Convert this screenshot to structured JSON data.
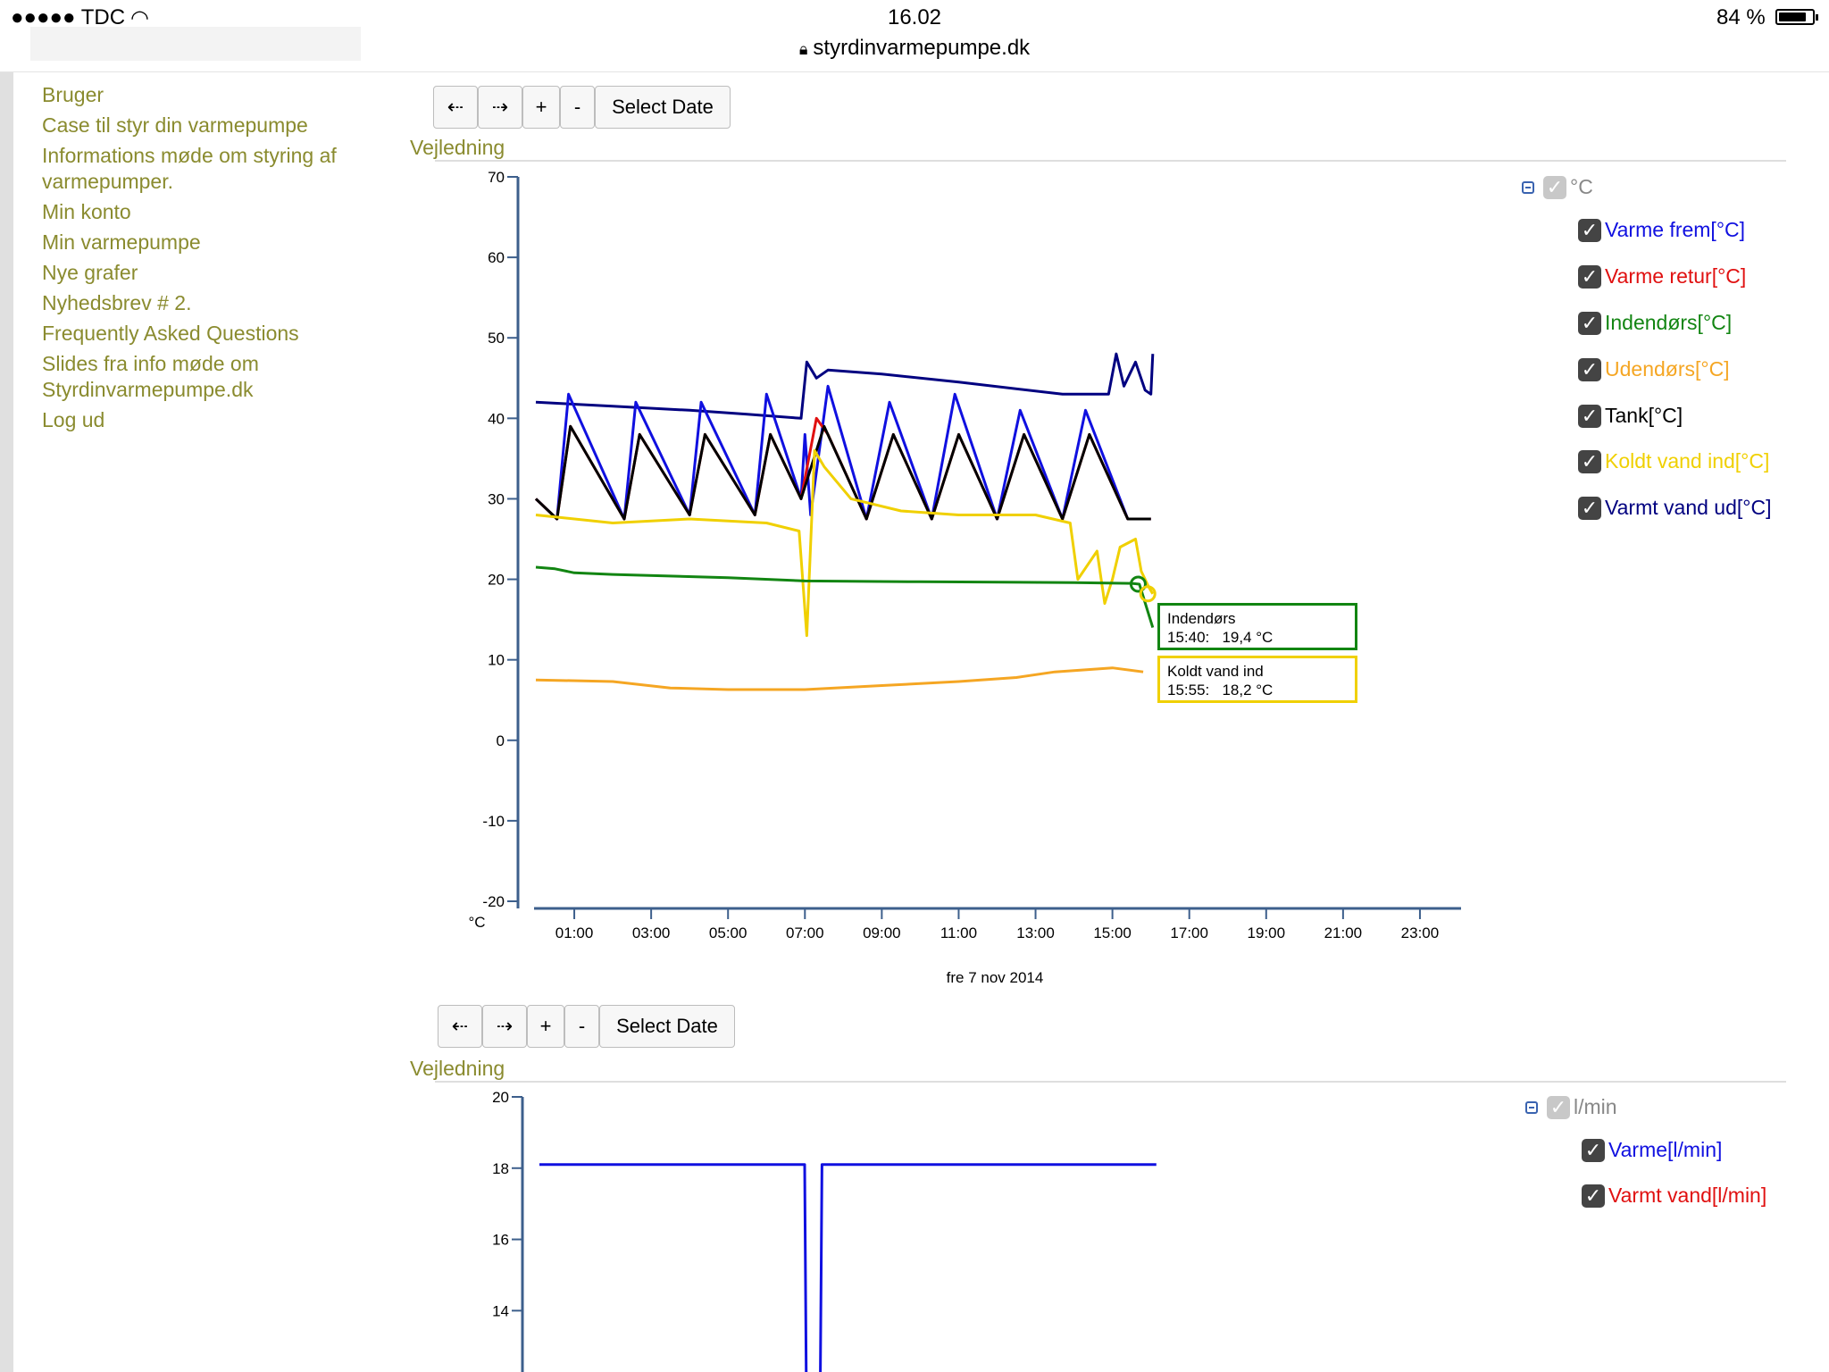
{
  "status_bar": {
    "carrier": "●●●●● TDC",
    "time": "16.02",
    "url": "styrdinvarmepumpe.dk",
    "battery": "84 %",
    "battery_level": 0.84
  },
  "sidebar": {
    "items": [
      {
        "label": "Bruger"
      },
      {
        "label": "Case til styr din varmepumpe"
      },
      {
        "label": "Informations møde om styring af varmepumper."
      },
      {
        "label": "Min konto"
      },
      {
        "label": "Min varmepumpe"
      },
      {
        "label": "Nye grafer"
      },
      {
        "label": "Nyhedsbrev # 2."
      },
      {
        "label": "Frequently Asked Questions"
      },
      {
        "label": "Slides fra info møde om Styrdinvarmepumpe.dk"
      },
      {
        "label": "Log ud"
      }
    ]
  },
  "toolbar": {
    "prev": "⇠",
    "next": "⇢",
    "zoom_in": "+",
    "zoom_out": "-",
    "select_date": "Select Date",
    "vejledning": "Vejledning"
  },
  "chart1": {
    "legend_group": "°C",
    "legend": [
      {
        "name": "Varme frem[°C]",
        "color": "#1010e0"
      },
      {
        "name": "Varme retur[°C]",
        "color": "#e01010"
      },
      {
        "name": "Indendørs[°C]",
        "color": "#128512"
      },
      {
        "name": "Udendørs[°C]",
        "color": "#f5a623"
      },
      {
        "name": "Tank[°C]",
        "color": "#000000"
      },
      {
        "name": "Koldt vand ind[°C]",
        "color": "#f0d000"
      },
      {
        "name": "Varmt vand ud[°C]",
        "color": "#000080"
      }
    ],
    "tooltips": [
      {
        "title": "Indendørs",
        "time": "15:40:",
        "value": "19,4 °C",
        "color": "#128512"
      },
      {
        "title": "Koldt vand ind",
        "time": "15:55:",
        "value": "18,2 °C",
        "color": "#f0d000"
      }
    ]
  },
  "chart2": {
    "legend_group": "l/min",
    "legend": [
      {
        "name": "Varme[l/min]",
        "color": "#1010e0"
      },
      {
        "name": "Varmt vand[l/min]",
        "color": "#e01010"
      }
    ]
  },
  "chart_data": [
    {
      "type": "line",
      "title": "",
      "xlabel": "fre 7 nov  2014",
      "ylabel": "°C",
      "ylim": [
        -20,
        70
      ],
      "xlim": [
        0,
        24
      ],
      "yticks": [
        "70",
        "60",
        "50",
        "40",
        "30",
        "20",
        "10",
        "0",
        "-10",
        "-20"
      ],
      "xticks": [
        "01:00",
        "03:00",
        "05:00",
        "07:00",
        "09:00",
        "11:00",
        "13:00",
        "15:00",
        "17:00",
        "19:00",
        "21:00",
        "23:00"
      ],
      "series": [
        {
          "name": "Varmt vand ud[°C]",
          "color": "#000080",
          "x": [
            0,
            2,
            4,
            5.5,
            6.9,
            7.05,
            7.3,
            7.6,
            9,
            11,
            13.7,
            14.9,
            15.1,
            15.3,
            15.6,
            15.85,
            16.0,
            16.05
          ],
          "y": [
            42,
            41.5,
            41,
            40.5,
            40,
            47,
            45,
            46,
            45.5,
            44.5,
            43,
            43,
            48,
            44,
            47,
            43.5,
            43,
            48
          ]
        },
        {
          "name": "Varme frem[°C]",
          "color": "#1010e0",
          "x": [
            0,
            0.55,
            0.85,
            2.3,
            2.6,
            4.0,
            4.3,
            5.7,
            6.0,
            6.9,
            7.0,
            7.15,
            7.6,
            8.6,
            9.2,
            10.3,
            10.9,
            12.0,
            12.6,
            13.7,
            14.3,
            15.4,
            16.0
          ],
          "y": [
            30,
            27.5,
            43,
            27.5,
            42,
            28,
            42,
            28,
            43,
            30,
            38,
            28,
            44,
            27.5,
            42,
            27.5,
            43,
            27.5,
            41,
            27.5,
            41,
            27.5,
            27.5
          ]
        },
        {
          "name": "Varme retur[°C]",
          "color": "#e01010",
          "x": [
            0,
            0.55,
            0.9,
            2.3,
            2.7,
            4.0,
            4.4,
            5.7,
            6.1,
            6.9,
            7.3,
            7.6,
            8.6,
            9.3,
            10.3,
            11.0,
            12.0,
            12.7,
            13.7,
            14.4,
            15.4,
            16.0
          ],
          "y": [
            30,
            27.5,
            39,
            27.5,
            38,
            28,
            38,
            28,
            38,
            30,
            40,
            38,
            27.5,
            38,
            27.5,
            38,
            27.5,
            38,
            27.5,
            38,
            27.5,
            27.5
          ]
        },
        {
          "name": "Tank[°C]",
          "color": "#000000",
          "x": [
            0,
            0.55,
            0.9,
            2.3,
            2.7,
            4.0,
            4.4,
            5.7,
            6.1,
            6.9,
            7.5,
            8.6,
            9.3,
            10.3,
            11.0,
            12.0,
            12.7,
            13.7,
            14.4,
            15.4,
            16.0
          ],
          "y": [
            30,
            27.5,
            39,
            27.5,
            38,
            28,
            38,
            28,
            38,
            30,
            39,
            27.5,
            38,
            27.5,
            38,
            27.5,
            38,
            27.5,
            38,
            27.5,
            27.5
          ]
        },
        {
          "name": "Koldt vand ind[°C]",
          "color": "#f0d000",
          "x": [
            0,
            2,
            4,
            6,
            6.85,
            7.05,
            7.25,
            7.5,
            8.2,
            9.5,
            11,
            13,
            13.9,
            14.1,
            14.6,
            14.8,
            15.0,
            15.2,
            15.6,
            15.75,
            15.95,
            16.05
          ],
          "y": [
            28,
            27,
            27.5,
            27,
            26,
            13,
            36,
            34,
            30,
            28.5,
            28,
            28,
            27,
            20,
            23.5,
            17,
            20,
            24,
            25,
            21,
            19,
            18.2
          ]
        },
        {
          "name": "Indendørs[°C]",
          "color": "#128512",
          "x": [
            0,
            0.5,
            1,
            2,
            5,
            7,
            10,
            14,
            15.5,
            15.7,
            16.05
          ],
          "y": [
            21.5,
            21.3,
            20.8,
            20.6,
            20.2,
            19.8,
            19.7,
            19.6,
            19.5,
            19.4,
            14
          ]
        },
        {
          "name": "Udendørs[°C]",
          "color": "#f5a623",
          "x": [
            0,
            2,
            3.5,
            5,
            7,
            9,
            11,
            12.5,
            13.5,
            15,
            15.8
          ],
          "y": [
            7.5,
            7.3,
            6.5,
            6.3,
            6.3,
            6.8,
            7.3,
            7.8,
            8.5,
            9,
            8.5
          ]
        }
      ],
      "markers": [
        {
          "series": "Indendørs[°C]",
          "x": 15.67,
          "y": 19.4
        },
        {
          "series": "Koldt vand ind[°C]",
          "x": 15.92,
          "y": 18.2
        }
      ]
    },
    {
      "type": "line",
      "title": "",
      "xlabel": "",
      "ylabel": "",
      "ylim": [
        11,
        20
      ],
      "xlim": [
        0,
        24
      ],
      "yticks": [
        "20",
        "18",
        "16",
        "14"
      ],
      "series": [
        {
          "name": "Varme[l/min]",
          "color": "#1010e0",
          "x": [
            0,
            1,
            2,
            3,
            4,
            5,
            6,
            6.9,
            6.95,
            7.3,
            7.35,
            8,
            9,
            10,
            11,
            12,
            13,
            14,
            15,
            16.05
          ],
          "y": [
            18.1,
            18.1,
            18.1,
            18.1,
            18.1,
            18.1,
            18.1,
            18.1,
            11,
            11,
            18.1,
            18.1,
            18.1,
            18.1,
            18.1,
            18.1,
            18.1,
            18.1,
            18.1,
            18.1
          ]
        },
        {
          "name": "Varmt vand[l/min]",
          "color": "#e01010",
          "x": [],
          "y": []
        }
      ]
    }
  ]
}
